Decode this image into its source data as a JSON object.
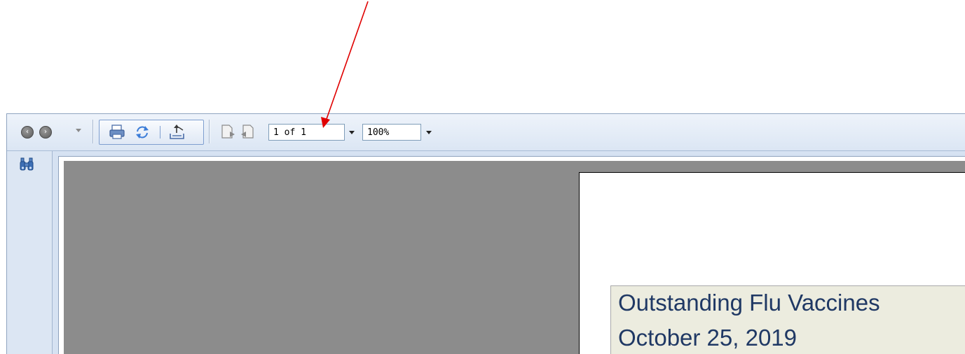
{
  "toolbar": {
    "page_field_value": "1 of 1",
    "zoom_field_value": "100%",
    "icons": {
      "back": "back-circle-icon",
      "forward": "forward-circle-icon",
      "print": "printer-icon",
      "refresh": "refresh-icon",
      "export": "export-icon",
      "prev_page": "previous-page-icon",
      "next_page": "next-page-icon",
      "find": "binoculars-icon"
    }
  },
  "report": {
    "title": "Outstanding Flu Vaccines",
    "date": "October 25, 2019"
  },
  "colors": {
    "annotation_arrow": "#e00000",
    "report_title_text": "#1f3864",
    "report_title_bg": "#ececdf",
    "viewer_gray": "#8c8c8c"
  }
}
